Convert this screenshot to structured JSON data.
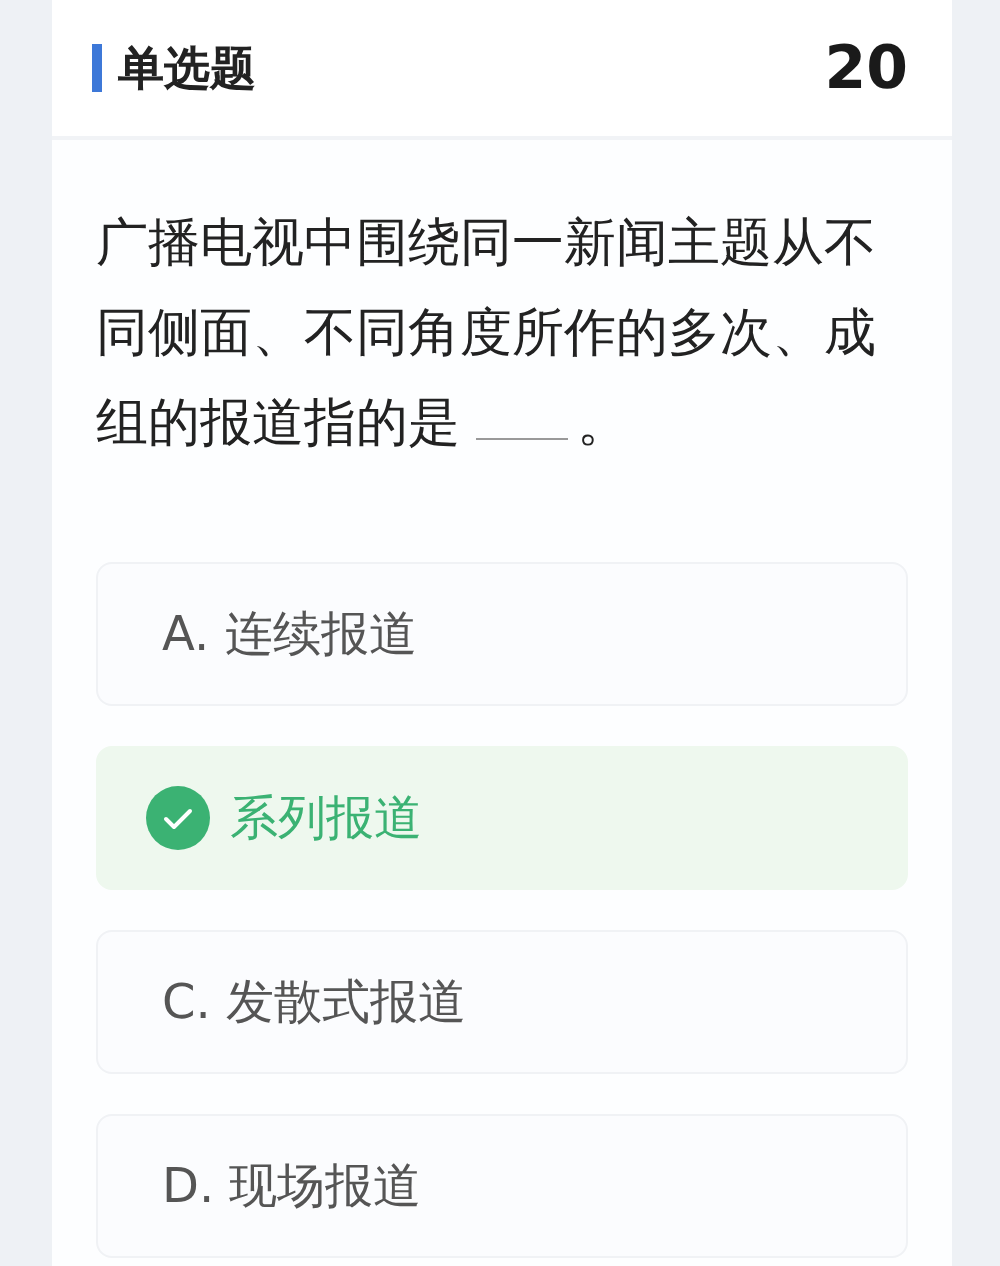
{
  "header": {
    "type_label": "单选题",
    "number": "20"
  },
  "question": {
    "text": "广播电视中围绕同一新闻主题从不同侧面、不同角度所作的多次、成组的报道指的是",
    "after_blank": "。"
  },
  "options": [
    {
      "letter": "A.",
      "text": "连续报道",
      "selected": false
    },
    {
      "text": "系列报道",
      "selected": true
    },
    {
      "letter": "C.",
      "text": "发散式报道",
      "selected": false
    },
    {
      "letter": "D.",
      "text": "现场报道",
      "selected": false
    }
  ]
}
